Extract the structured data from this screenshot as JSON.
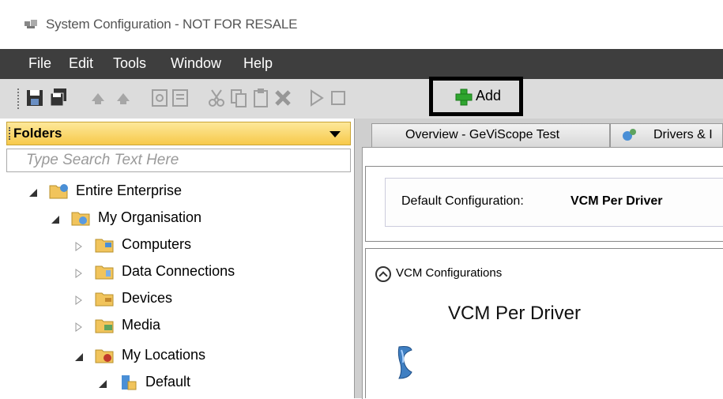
{
  "window": {
    "title": "System Configuration - NOT FOR RESALE"
  },
  "menu": [
    "File",
    "Edit",
    "Tools",
    "Window",
    "Help"
  ],
  "toolbar": {
    "add_label": "Add",
    "icons": [
      "save-icon",
      "save-all-icon",
      "undo-icon",
      "redo-icon",
      "preview-icon",
      "properties-icon",
      "cut-icon",
      "copy-icon",
      "paste-icon",
      "delete-icon",
      "run-icon",
      "stop-icon",
      "add-icon"
    ]
  },
  "folders": {
    "header": "Folders",
    "search_placeholder": "Type Search Text Here",
    "tree": [
      {
        "label": "Entire Enterprise",
        "expanded": true
      },
      {
        "label": "My Organisation",
        "expanded": true
      },
      {
        "label": "Computers",
        "expanded": false
      },
      {
        "label": "Data Connections",
        "expanded": false
      },
      {
        "label": "Devices",
        "expanded": false
      },
      {
        "label": "Media",
        "expanded": false
      },
      {
        "label": "My Locations",
        "expanded": true
      },
      {
        "label": "Default",
        "expanded": true
      }
    ]
  },
  "tabs": [
    {
      "label": "Overview - GeViScope Test"
    },
    {
      "label": "Drivers & I"
    }
  ],
  "overview": {
    "default_config_label": "Default Configuration:",
    "default_config_value": "VCM Per Driver",
    "section_title": "VCM Configurations",
    "config_name": "VCM Per Driver"
  },
  "colors": {
    "menubar": "#3e3e3e",
    "toolbar": "#dcdcdc",
    "folders_header": "#f7c94a",
    "add_icon": "#2fa52f"
  }
}
